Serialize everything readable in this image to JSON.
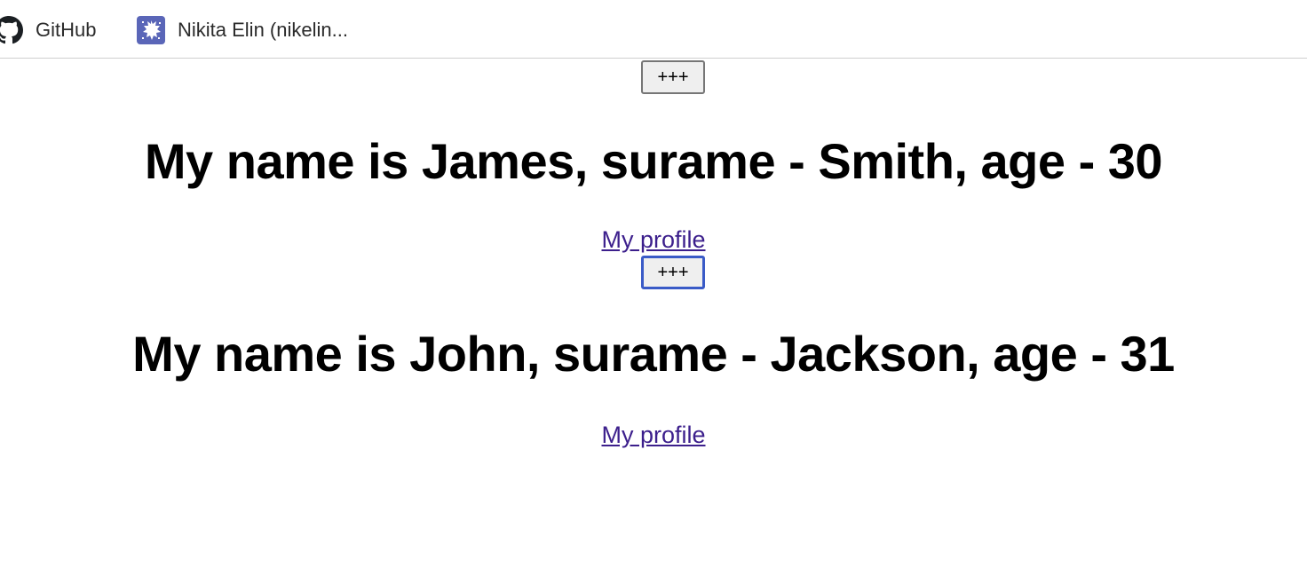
{
  "bookmarks": [
    {
      "label": "GitHub",
      "icon": "github-icon"
    },
    {
      "label": "Nikita Elin (nikelin...",
      "icon": "favicon-icon"
    }
  ],
  "people": [
    {
      "button_label": "+++",
      "title": "My name is James, surame - Smith, age - 30",
      "link_label": "My profile"
    },
    {
      "button_label": "+++",
      "title": "My name is John, surame - Jackson, age - 31",
      "link_label": "My profile"
    }
  ],
  "colors": {
    "link": "#3c1f8c",
    "focus_ring": "#3a5bc7",
    "button_bg": "#efefef",
    "favicon_bg": "#5a66b8"
  }
}
